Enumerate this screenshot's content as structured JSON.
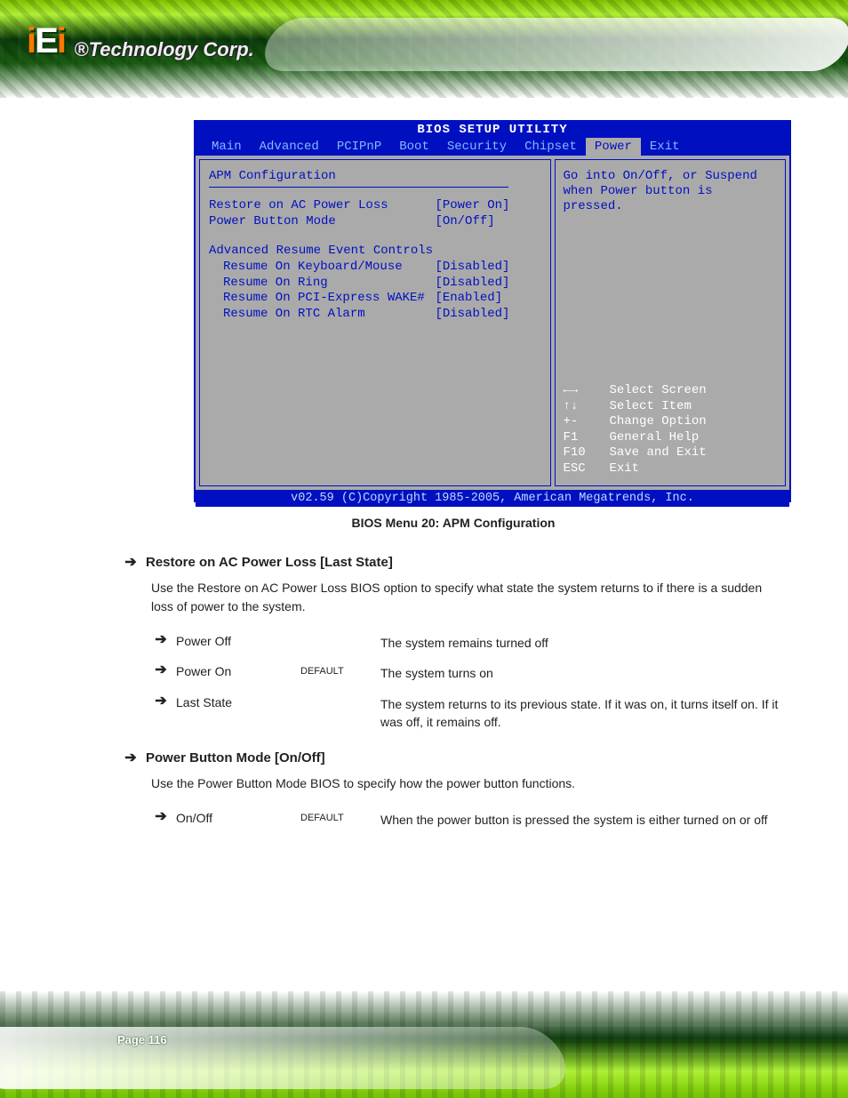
{
  "logo": {
    "mark_prefix": "i",
    "mark_mid": "E",
    "mark_suffix": "i",
    "tagline": "®Technology Corp."
  },
  "bios": {
    "title": "BIOS SETUP UTILITY",
    "tabs": [
      "Main",
      "Advanced",
      "PCIPnP",
      "Boot",
      "Security",
      "Chipset",
      "Power",
      "Exit"
    ],
    "selected_tab": "Power",
    "section_title": "APM Configuration",
    "rows": [
      {
        "label": "Restore on AC Power Loss",
        "value": "[Power On]",
        "indent": false
      },
      {
        "label": "Power Button Mode",
        "value": "[On/Off]",
        "indent": false
      }
    ],
    "subsection_title": "Advanced Resume Event Controls",
    "sub_rows": [
      {
        "label": "Resume On Keyboard/Mouse",
        "value": "[Disabled]"
      },
      {
        "label": "Resume On Ring",
        "value": "[Disabled]"
      },
      {
        "label": "Resume On PCI-Express WAKE#",
        "value": "[Enabled]"
      },
      {
        "label": "Resume On RTC Alarm",
        "value": "[Disabled]"
      }
    ],
    "help_text": "Go into On/Off, or Suspend when Power button is pressed.",
    "keys": [
      {
        "k": "←→",
        "a": "Select Screen"
      },
      {
        "k": "↑↓",
        "a": "Select Item"
      },
      {
        "k": "+-",
        "a": "Change Option"
      },
      {
        "k": "F1",
        "a": "General Help"
      },
      {
        "k": "F10",
        "a": "Save and Exit"
      },
      {
        "k": "ESC",
        "a": "Exit"
      }
    ],
    "footer": "v02.59 (C)Copyright 1985-2005, American Megatrends, Inc."
  },
  "doc": {
    "caption": "BIOS Menu 20: APM Configuration",
    "opt1": {
      "title": "Restore on AC Power Loss [Last State]",
      "desc": "Use the Restore on AC Power Loss BIOS option to specify what state the system returns to if there is a sudden loss of power to the system.",
      "items": [
        {
          "term": "Power Off",
          "note": "",
          "expl": "The system remains turned off"
        },
        {
          "term": "Power On",
          "note": "DEFAULT",
          "expl": "The system turns on"
        },
        {
          "term": "Last State",
          "note": "",
          "expl": "The system returns to its previous state. If it was on, it turns itself on. If it was off, it remains off."
        }
      ]
    },
    "opt2": {
      "title": "Power Button Mode [On/Off]",
      "desc": "Use the Power Button Mode BIOS to specify how the power button functions.",
      "items": [
        {
          "term": "On/Off",
          "note": "DEFAULT",
          "expl": "When the power button is pressed the system is either turned on or off"
        }
      ]
    }
  },
  "page_info": {
    "number": "Page 116"
  }
}
